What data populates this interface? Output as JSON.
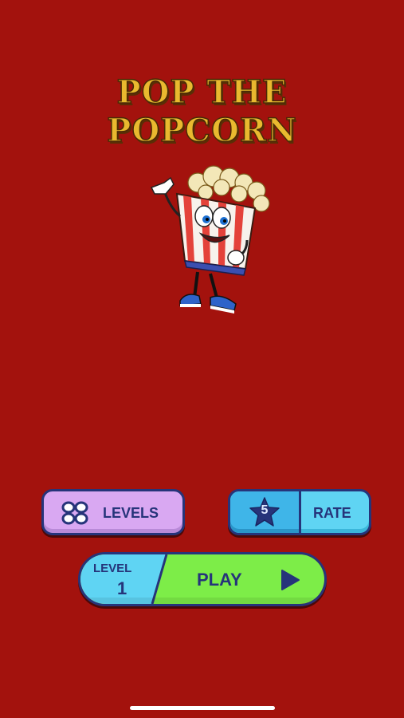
{
  "title": {
    "line1": "POP THE",
    "line2": "POPCORN"
  },
  "menu": {
    "levels_label": "LEVELS",
    "rate_label": "RATE",
    "rate_star_number": "5",
    "play_label": "PLAY",
    "level_label": "LEVEL",
    "level_number": "1"
  },
  "icons": {
    "levels": "four-circles-grid-icon",
    "rate": "star-icon",
    "play": "play-triangle-icon",
    "mascot": "popcorn-mascot"
  },
  "colors": {
    "background": "#a3120d",
    "title": "#e9b92f",
    "levels_button": "#d9a8f2",
    "rate_button": "#5fd4f3",
    "play_button": "#7ded48",
    "outline": "#26347a"
  }
}
